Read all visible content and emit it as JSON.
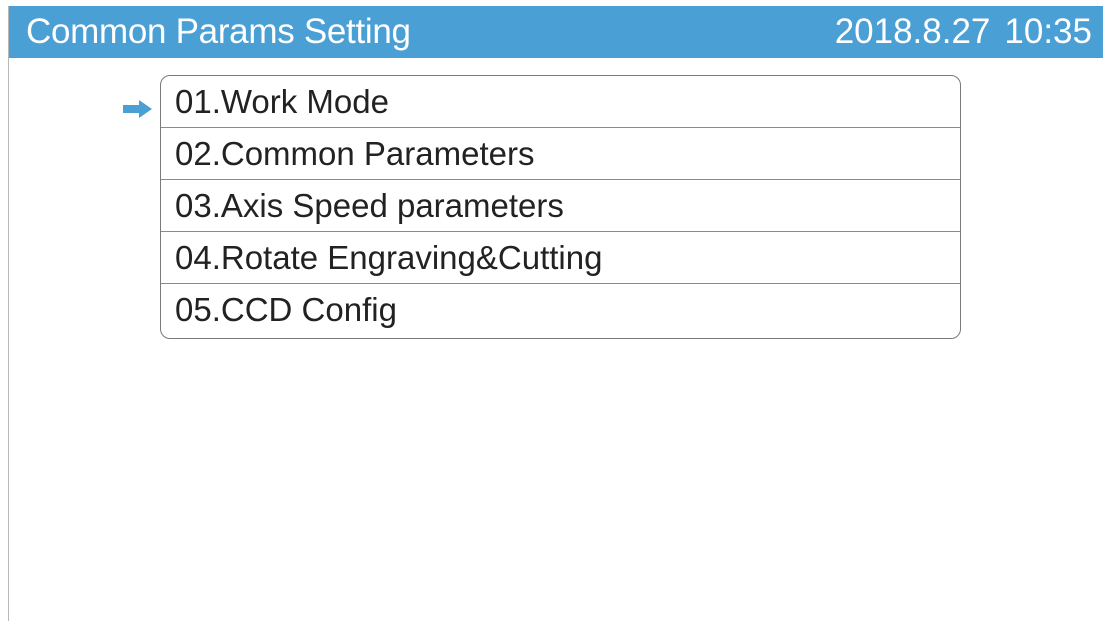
{
  "header": {
    "title": "Common Params Setting",
    "date": "2018.8.27",
    "time": "10:35",
    "background_color": "#4a9fd4"
  },
  "menu": {
    "selected_index": 0,
    "selector_icon": "arrow-right-icon",
    "items": [
      {
        "label": "01.Work Mode"
      },
      {
        "label": "02.Common Parameters"
      },
      {
        "label": "03.Axis Speed parameters"
      },
      {
        "label": "04.Rotate Engraving&Cutting"
      },
      {
        "label": "05.CCD Config"
      }
    ]
  }
}
